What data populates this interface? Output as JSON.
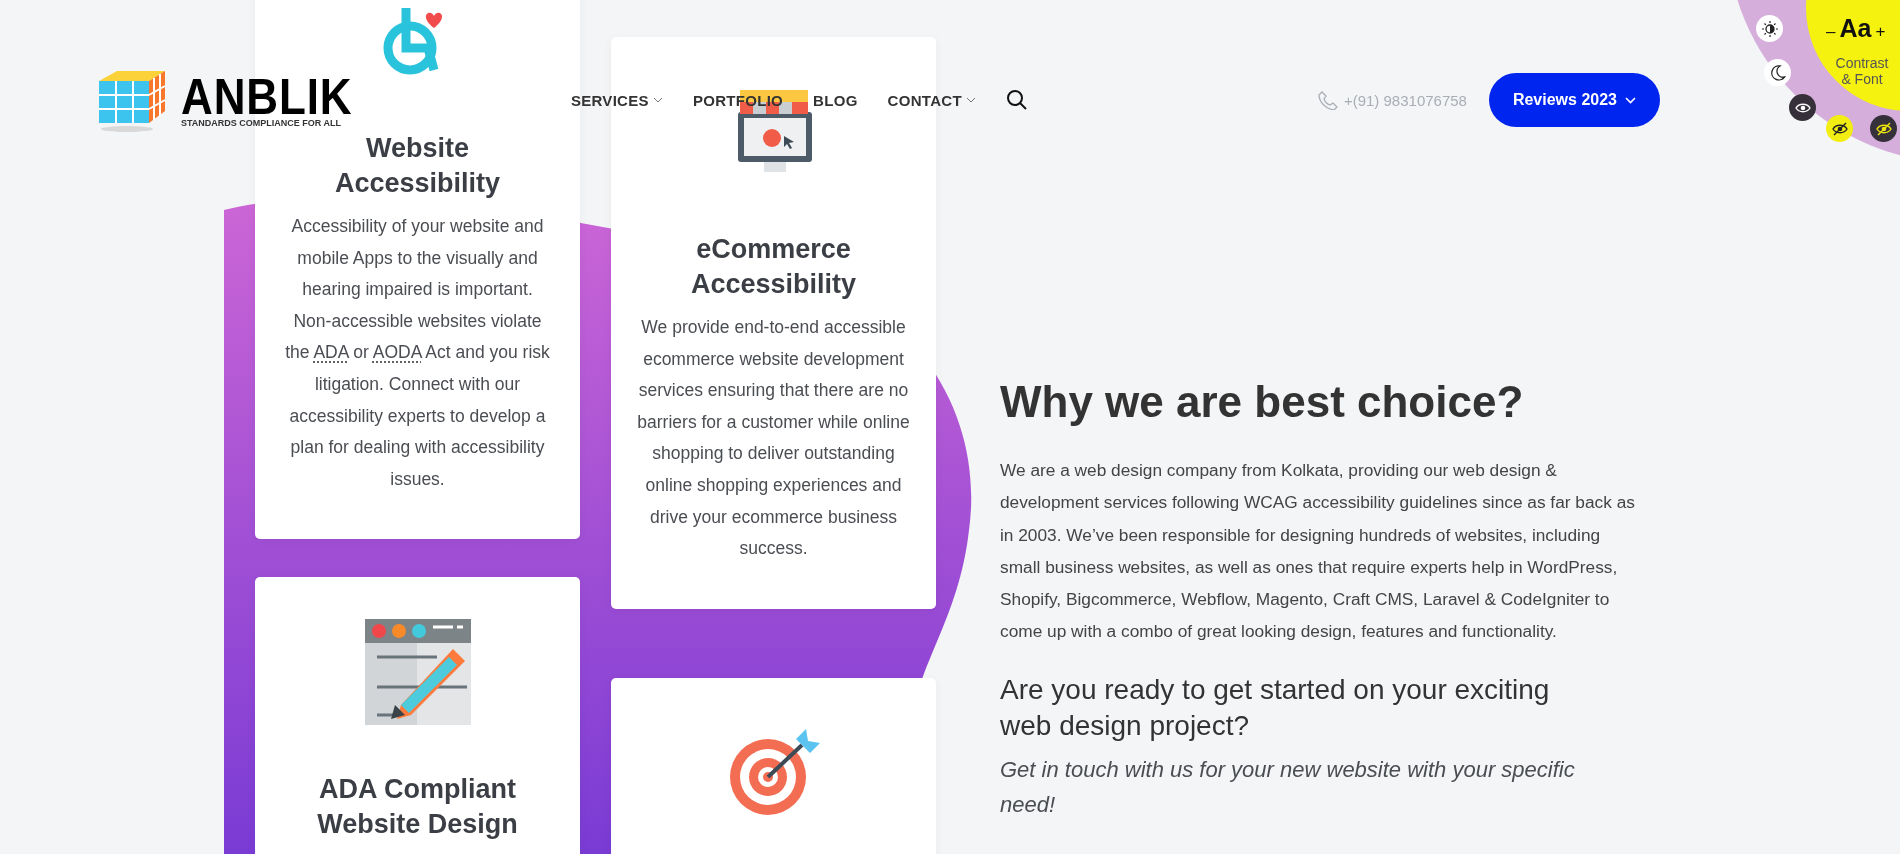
{
  "header": {
    "logo": {
      "name": "ANBLIK",
      "tagline": "STANDARDS COMPLIANCE FOR ALL"
    },
    "nav": [
      {
        "label": "SERVICES",
        "dropdown": true
      },
      {
        "label": "PORTFOLIO",
        "dropdown": false
      },
      {
        "label": "BLOG",
        "dropdown": false
      },
      {
        "label": "CONTACT",
        "dropdown": true
      }
    ],
    "phone": "+(91) 9831076758",
    "reviews_button": "Reviews 2023"
  },
  "accessibility_widget": {
    "decrease": "–",
    "sample": "Aa",
    "increase": "+",
    "label": "Contrast & Font",
    "buttons": [
      {
        "kind": "contrast"
      },
      {
        "kind": "moon"
      },
      {
        "kind": "eye"
      },
      {
        "kind": "eye-off-light"
      },
      {
        "kind": "eye-off-dark"
      }
    ]
  },
  "service_columns": [
    [
      {
        "kind": "wheelchair",
        "title": "Website Accessibility",
        "paragraph": [
          {
            "text": "Accessibility of your website and mobile Apps to the visually and hearing impaired is important. Non-accessible websites violate the ",
            "abbr": false
          },
          {
            "text": "ADA",
            "abbr": true
          },
          {
            "text": " or ",
            "abbr": false
          },
          {
            "text": "AODA",
            "abbr": true
          },
          {
            "text": " Act and you risk litigation. Connect with our accessibility experts to develop a plan for dealing with accessibility issues.",
            "abbr": false
          }
        ]
      },
      {
        "kind": "pencil",
        "title": "ADA Compliant Website Design"
      }
    ],
    [
      {
        "kind": "shop",
        "title": "eCommerce Accessibility",
        "paragraph": [
          {
            "text": "We provide end-to-end accessible ecommerce website development services ensuring that there are no barriers for a customer while online shopping to deliver outstanding online shopping experiences and drive your ecommerce business success.",
            "abbr": false
          }
        ]
      },
      {
        "kind": "target"
      }
    ]
  ],
  "about": {
    "title": "Why we are best choice?",
    "paragraph": "We are a web design company from Kolkata, providing our web design & development services following WCAG accessibility guidelines since as far back as in 2003. We’ve been responsible for designing hundreds of websites, including small business websites, as well as ones that require experts help in WordPress, Shopify, Bigcommerce, Webflow, Magento, Craft CMS, Laravel & CodeIgniter to come up with a combo of great looking design, features and functionality.",
    "subheading": "Are you ready to get started on your exciting web design project?",
    "cta": "Get in touch with us for your new website with your specific need!"
  }
}
